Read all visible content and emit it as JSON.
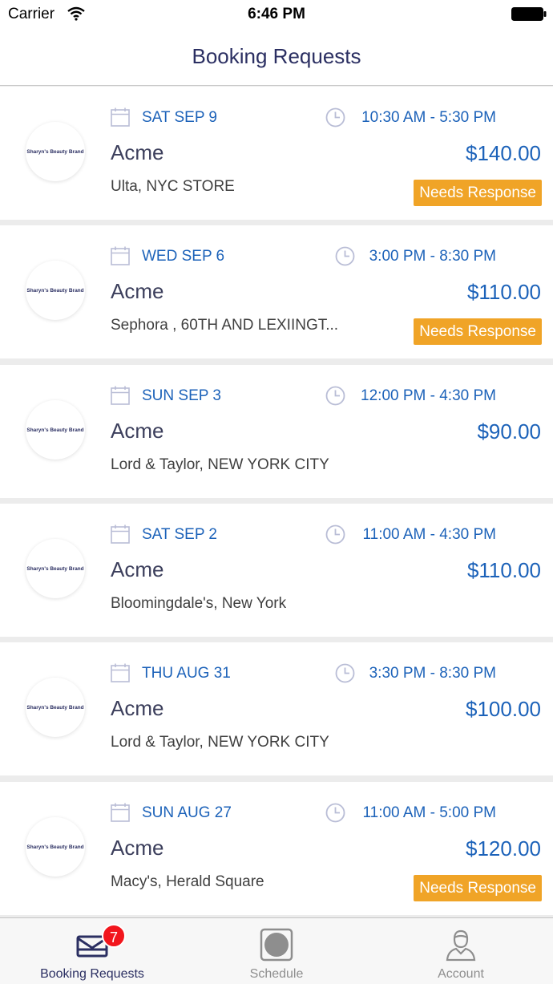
{
  "status_bar": {
    "carrier": "Carrier",
    "time": "6:46 PM"
  },
  "header": {
    "title": "Booking Requests"
  },
  "bookings": [
    {
      "logo_text": "Sharyn's Beauty Brand",
      "date": "SAT SEP 9",
      "time": "10:30 AM - 5:30 PM",
      "brand": "Acme",
      "price": "$140.00",
      "location": "Ulta, NYC STORE",
      "badge": "Needs Response"
    },
    {
      "logo_text": "Sharyn's Beauty Brand",
      "date": "WED SEP 6",
      "time": "3:00 PM - 8:30 PM",
      "brand": "Acme",
      "price": "$110.00",
      "location": " Sephora , 60TH AND LEXIINGT...",
      "badge": "Needs Response"
    },
    {
      "logo_text": "Sharyn's Beauty Brand",
      "date": "SUN SEP 3",
      "time": "12:00 PM - 4:30 PM",
      "brand": "Acme",
      "price": "$90.00",
      "location": "Lord & Taylor, NEW YORK CITY",
      "badge": ""
    },
    {
      "logo_text": "Sharyn's Beauty Brand",
      "date": "SAT SEP 2",
      "time": "11:00 AM - 4:30 PM",
      "brand": "Acme",
      "price": "$110.00",
      "location": "Bloomingdale's, New York",
      "badge": ""
    },
    {
      "logo_text": "Sharyn's Beauty Brand",
      "date": "THU AUG 31",
      "time": "3:30 PM - 8:30 PM",
      "brand": "Acme",
      "price": "$100.00",
      "location": "Lord & Taylor, NEW YORK CITY",
      "badge": ""
    },
    {
      "logo_text": "Sharyn's Beauty Brand",
      "date": "SUN AUG 27",
      "time": "11:00 AM - 5:00 PM",
      "brand": "Acme",
      "price": "$120.00",
      "location": "Macy's, Herald Square",
      "badge": "Needs Response"
    }
  ],
  "tab_bar": {
    "tabs": [
      {
        "label": "Booking Requests",
        "icon": "mail-tray-icon",
        "badge": "7",
        "active": true
      },
      {
        "label": "Schedule",
        "icon": "schedule-icon",
        "badge": "",
        "active": false
      },
      {
        "label": "Account",
        "icon": "user-icon",
        "badge": "",
        "active": false
      }
    ]
  },
  "colors": {
    "accent": "#1c62b9",
    "title": "#2b2f62",
    "badge": "#f0a427",
    "notification": "#f2161d"
  }
}
